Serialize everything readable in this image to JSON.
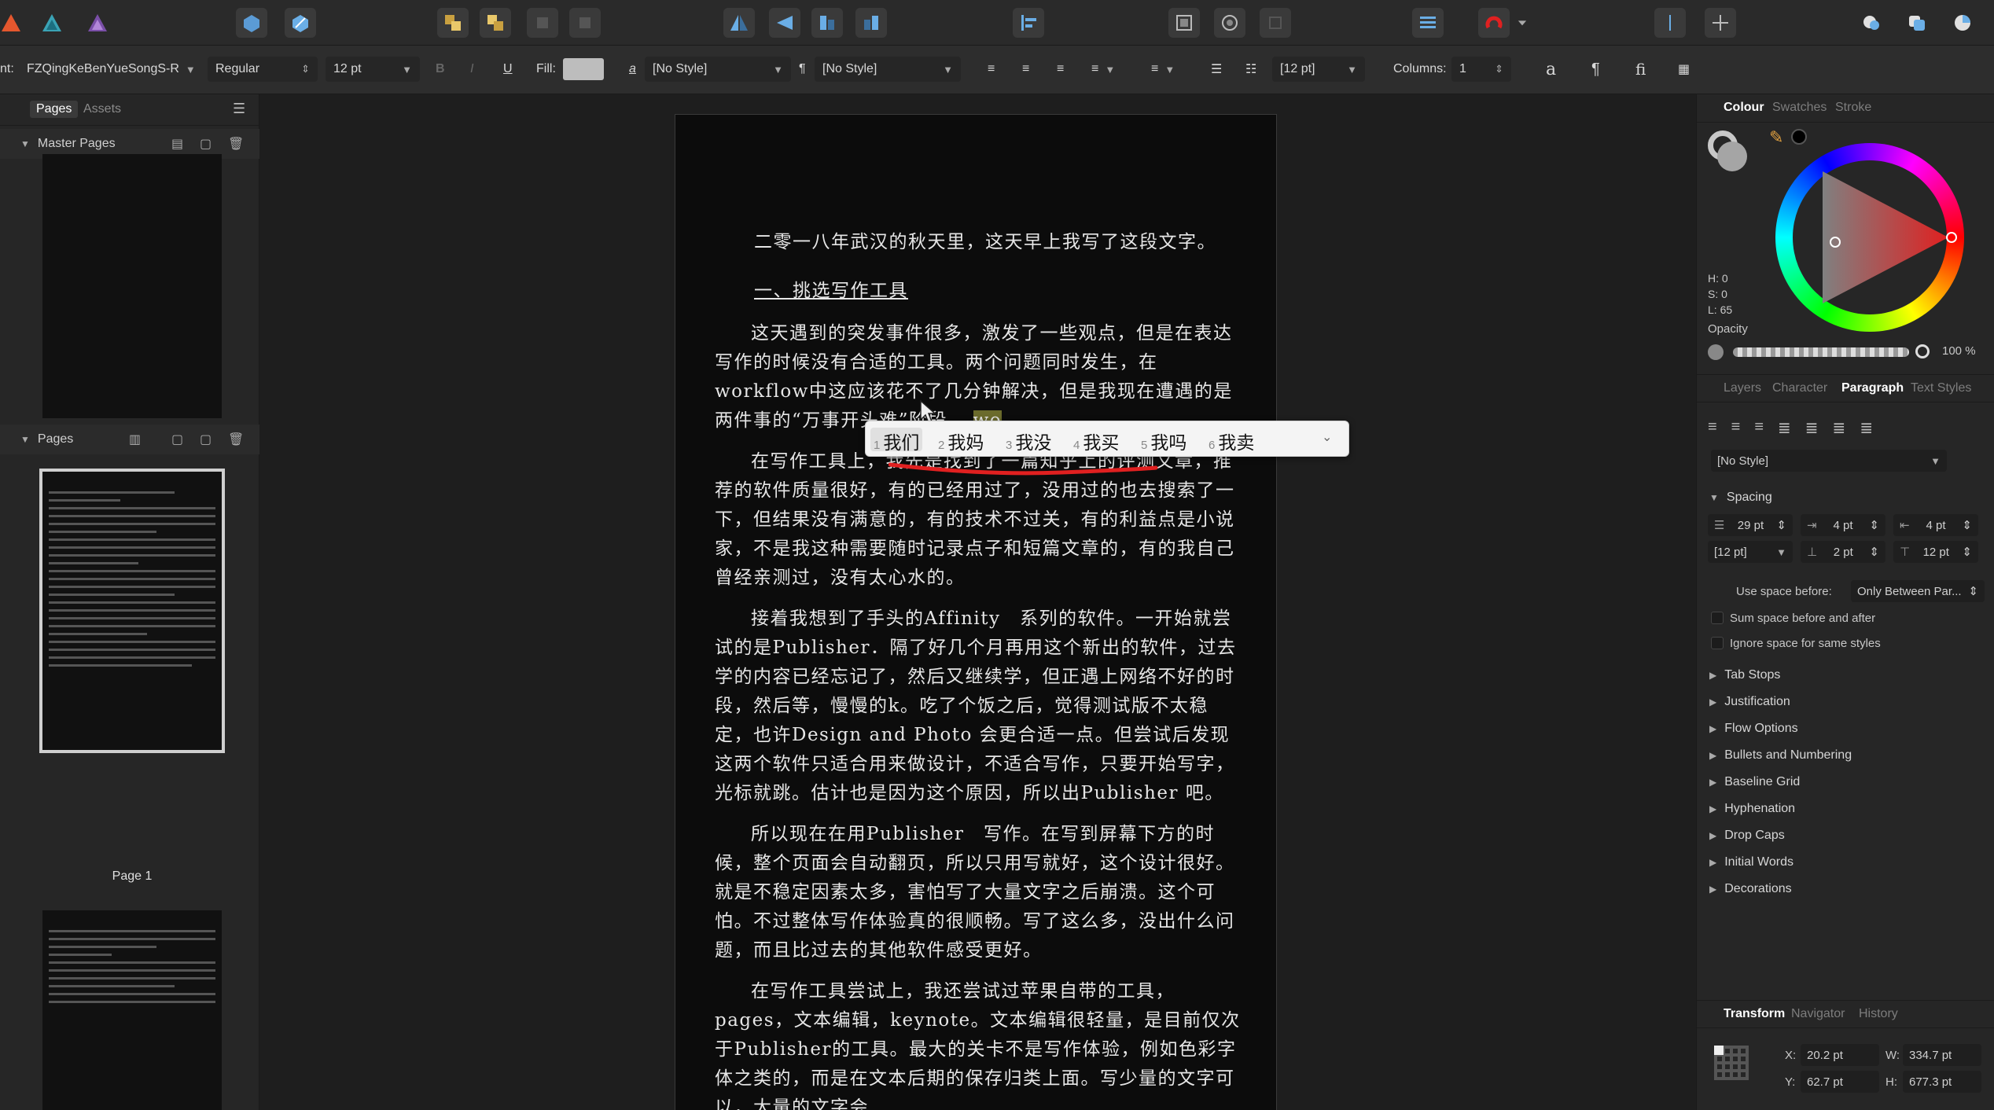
{
  "toolbar": {
    "icons": [
      "publisher-persona-icon",
      "designer-persona-icon",
      "photo-persona-icon",
      "insert-icon",
      "edit-icon",
      "arrange-front-icon",
      "arrange-back-icon",
      "flip-horizontal-icon",
      "flip-vertical-icon",
      "align-icon",
      "snapping-icon",
      "assistant-icon",
      "view-icon",
      "guides-icon"
    ]
  },
  "context": {
    "font_label": "nt:",
    "font_name": "FZQingKeBenYueSongS-R",
    "font_style": "Regular",
    "font_size": "12 pt",
    "bold": "B",
    "italic": "I",
    "underline": "U",
    "fill_label": "Fill:",
    "char_style": "[No Style]",
    "para_style": "[No Style]",
    "leading": "[12 pt]",
    "columns_label": "Columns:",
    "columns_value": "1",
    "glyph_a": "a",
    "pilcrow": "¶",
    "fi": "fi"
  },
  "left_panel": {
    "tab_pages": "Pages",
    "tab_assets": "Assets",
    "master_pages": "Master Pages",
    "pages": "Pages",
    "page1_label": "Page 1"
  },
  "document": {
    "line1": "二零一八年武汉的秋天里，这天早上我写了这段文字。",
    "heading": "一、挑选写作工具",
    "para1": "这天遇到的突发事件很多，激发了一些观点，但是在表达写作的时候没有合适的工具。两个问题同时发生，在workflow中这应该花不了几分钟解决，但是我现在遭遇的是两件事的“万事开头难”阶段。",
    "ime_composition": "wo",
    "para2": "在写作工具上，我先是找到了一篇知乎上的评测文章，推荐的软件质量很好，有的已经用过了，没用过的也去搜索了一下，但结果没有满意的，有的技术不过关，有的利益点是小说家，不是我这种需要随时记录点子和短篇文章的，有的我自己曾经亲测过，没有太心水的。",
    "para3": "接着我想到了手头的Affinity　系列的软件。一开始就尝试的是Publisher．隔了好几个月再用这个新出的软件，过去学的内容已经忘记了，然后又继续学，但正遇上网络不好的时段，然后等，慢慢的k。吃了个饭之后，觉得测试版不太稳定，也许Design and Photo 会更合适一点。但尝试后发现这两个软件只适合用来做设计，不适合写作，只要开始写字，光标就跳。估计也是因为这个原因，所以出Publisher 吧。",
    "para4": "所以现在在用Publisher　写作。在写到屏幕下方的时候，整个页面会自动翻页，所以只用写就好，这个设计很好。就是不稳定因素太多，害怕写了大量文字之后崩溃。这个可怕。不过整体写作体验真的很顺畅。写了这么多，没出什么问题，而且比过去的其他软件感受更好。",
    "para5": "在写作工具尝试上，我还尝试过苹果自带的工具，pages，文本编辑，keynote。文本编辑很轻量，是目前仅次于Publisher的工具。最大的关卡不是写作体验，例如色彩字体之类的，而是在文本后期的保存归类上面。写少量的文字可以，大量的文字会"
  },
  "ime": {
    "candidates": [
      {
        "num": "1",
        "text": "我们"
      },
      {
        "num": "2",
        "text": "我妈"
      },
      {
        "num": "3",
        "text": "我没"
      },
      {
        "num": "4",
        "text": "我买"
      },
      {
        "num": "5",
        "text": "我吗"
      },
      {
        "num": "6",
        "text": "我卖"
      }
    ]
  },
  "right_panel": {
    "tab_colour": "Colour",
    "tab_swatches": "Swatches",
    "tab_stroke": "Stroke",
    "h": "H: 0",
    "s": "S: 0",
    "l": "L: 65",
    "opacity_label": "Opacity",
    "opacity_value": "100 %",
    "tab_layers": "Layers",
    "tab_character": "Character",
    "tab_paragraph": "Paragraph",
    "tab_text_styles": "Text Styles",
    "para_style": "[No Style]",
    "spacing": "Spacing",
    "sp_leading": "29 pt",
    "sp_left": "4 pt",
    "sp_right": "4 pt",
    "sp_baseline": "[12 pt]",
    "sp_before": "2 pt",
    "sp_after": "12 pt",
    "use_space_before": "Use space before:",
    "use_space_before_value": "Only Between Par...",
    "sum_space": "Sum space before and after",
    "ignore_space": "Ignore space for same styles",
    "sections": [
      "Tab Stops",
      "Justification",
      "Flow Options",
      "Bullets and Numbering",
      "Baseline Grid",
      "Hyphenation",
      "Drop Caps",
      "Initial Words",
      "Decorations"
    ],
    "tab_transform": "Transform",
    "tab_navigator": "Navigator",
    "tab_history": "History",
    "x": "20.2 pt",
    "y": "62.7 pt",
    "w": "334.7 pt",
    "h_field": "677.3 pt",
    "x_label": "X:",
    "y_label": "Y:",
    "w_label": "W:",
    "h_label": "H:"
  },
  "colors": {
    "accent_red": "#e02020",
    "ime_highlight": "#6b6b2c"
  }
}
